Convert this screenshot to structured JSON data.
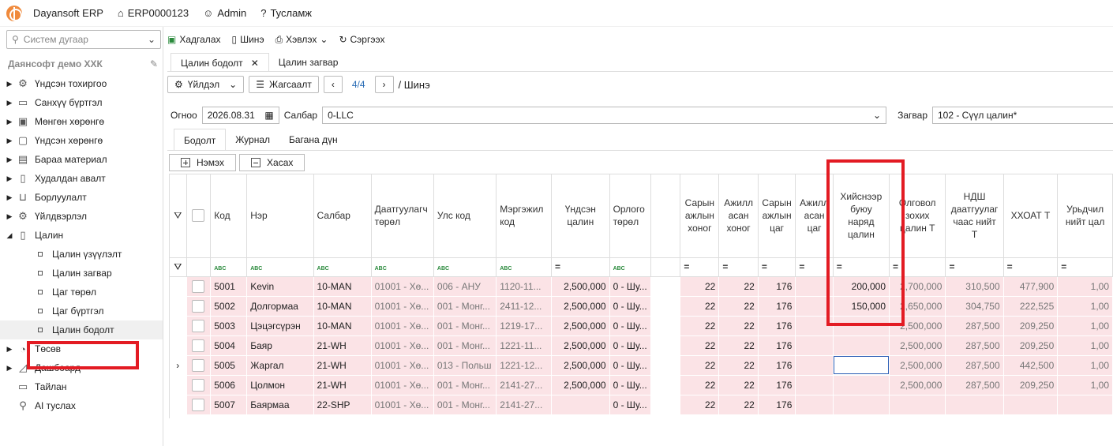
{
  "topbar": {
    "app": "Dayansoft ERP",
    "code": "ERP0000123",
    "user": "Admin",
    "help": "Тусламж"
  },
  "sidebar": {
    "search_placeholder": "Систем дугаар",
    "company": "Даянсофт демо ХХК",
    "items": [
      {
        "label": "Үндсэн тохиргоо",
        "icon": "gear-icon",
        "glyph": "⚙"
      },
      {
        "label": "Санхүү бүртгэл",
        "icon": "ledger-icon",
        "glyph": "▭"
      },
      {
        "label": "Мөнгөн хөрөнгө",
        "icon": "cash-icon",
        "glyph": "▣"
      },
      {
        "label": "Үндсэн хөрөнгө",
        "icon": "asset-icon",
        "glyph": "▢"
      },
      {
        "label": "Бараа материал",
        "icon": "inventory-icon",
        "glyph": "▤"
      },
      {
        "label": "Худалдан авалт",
        "icon": "purchase-icon",
        "glyph": "▯"
      },
      {
        "label": "Борлуулалт",
        "icon": "cart-icon",
        "glyph": "⊔"
      },
      {
        "label": "Үйлдвэрлэл",
        "icon": "production-icon",
        "glyph": "⚙"
      },
      {
        "label": "Цалин",
        "icon": "salary-icon",
        "glyph": "▯"
      }
    ],
    "subitems": [
      "Цалин үзүүлэлт",
      "Цалин загвар",
      "Цаг төрөл",
      "Цаг бүртгэл",
      "Цалин бодолт"
    ],
    "items_after": [
      {
        "label": "Төсөв",
        "icon": "budget-icon",
        "glyph": "◔"
      },
      {
        "label": "Дашбоард",
        "icon": "dashboard-icon",
        "glyph": "◿"
      },
      {
        "label": "Тайлан",
        "icon": "report-icon",
        "glyph": "▭"
      },
      {
        "label": "AI туслах",
        "icon": "assistant-icon",
        "glyph": "⚲"
      }
    ]
  },
  "toolbar": {
    "save": "Хадгалах",
    "new": "Шинэ",
    "print": "Хэвлэх",
    "refresh": "Сэргээх"
  },
  "tabs": {
    "active": "Цалин бодолт",
    "other": "Цалин загвар"
  },
  "nav": {
    "action": "Үйлдэл",
    "sort": "Жагсаалт",
    "page": "4/4",
    "crumb": "/ Шинэ"
  },
  "filters": {
    "date_label": "Огноо",
    "date": "2026.08.31",
    "branch_label": "Салбар",
    "branch": "0-LLC",
    "template_label": "Загвар",
    "template": "102 - Сүүл цалин*"
  },
  "subtabs": [
    "Бодолт",
    "Журнал",
    "Багана дүн"
  ],
  "actions": {
    "add": "Нэмэх",
    "remove": "Хасах"
  },
  "grid": {
    "headers": [
      "Код",
      "Нэр",
      "Салбар",
      "Даатгуулагч төрөл",
      "Улс код",
      "Мэргэжил код",
      "Үндсэн цалин",
      "Орлого төрөл",
      "Сарын ажлын хоног",
      "Ажилласан хоног",
      "Сарын ажлын цаг",
      "Ажилласан цаг",
      "Хийснээр буюу наряд цалин",
      "Олговол зохих цалин Т",
      "НДШ даатгуулагчаас нийт Т",
      "ХХОАТ Т",
      "Урьдчилгаа нийт цалин"
    ],
    "header_visible": [
      "Код",
      "Нэр",
      "Салбар",
      "Даатгуулагч\nтөрөл",
      "Улс код",
      "Мэргэжил\nкод",
      "Үндсэн\nцалин",
      "Орлого\nтөрөл",
      "Сарын\nажлын\nхоног",
      "Ажилл\nасан\nхоног",
      "Сарын\nажлын\nцаг",
      "Ажилл\nасан\nцаг",
      "Хийснээр\nбуюу\nнаряд\nцалин",
      "Олговол\nзохих\nцалин Т",
      "НДШ\nдаатгуулаг\nчаас нийт\nТ",
      "ХХОАТ Т",
      "Урьдчил\nнийт цал"
    ],
    "rows": [
      [
        "5001",
        "Kevin",
        "10-MAN",
        "01001 - Хө...",
        "006 - АНУ",
        "1120-11...",
        "2,500,000",
        "0 - Шу...",
        "22",
        "22",
        "176",
        "",
        "200,000",
        "2,700,000",
        "310,500",
        "477,900",
        "1,00"
      ],
      [
        "5002",
        "Долгормаа",
        "10-MAN",
        "01001 - Хө...",
        "001 - Монг...",
        "2411-12...",
        "2,500,000",
        "0 - Шу...",
        "22",
        "22",
        "176",
        "",
        "150,000",
        "2,650,000",
        "304,750",
        "222,525",
        "1,00"
      ],
      [
        "5003",
        "Цэцэгсүрэн",
        "10-MAN",
        "01001 - Хө...",
        "001 - Монг...",
        "1219-17...",
        "2,500,000",
        "0 - Шу...",
        "22",
        "22",
        "176",
        "",
        "",
        "2,500,000",
        "287,500",
        "209,250",
        "1,00"
      ],
      [
        "5004",
        "Баяр",
        "21-WH",
        "01001 - Хө...",
        "001 - Монг...",
        "1221-11...",
        "2,500,000",
        "0 - Шу...",
        "22",
        "22",
        "176",
        "",
        "",
        "2,500,000",
        "287,500",
        "209,250",
        "1,00"
      ],
      [
        "5005",
        "Жаргал",
        "21-WH",
        "01001 - Хө...",
        "013 - Польш",
        "1221-12...",
        "2,500,000",
        "0 - Шу...",
        "22",
        "22",
        "176",
        "",
        "",
        "2,500,000",
        "287,500",
        "442,500",
        "1,00"
      ],
      [
        "5006",
        "Цолмон",
        "21-WH",
        "01001 - Хө...",
        "001 - Монг...",
        "2141-27...",
        "2,500,000",
        "0 - Шу...",
        "22",
        "22",
        "176",
        "",
        "",
        "2,500,000",
        "287,500",
        "209,250",
        "1,00"
      ],
      [
        "5007",
        "Баярмаа",
        "22-SHP",
        "01001 - Хө...",
        "001 - Монг...",
        "2141-27...",
        "",
        "0 - Шу...",
        "22",
        "22",
        "176",
        "",
        "",
        "",
        "",
        "",
        ""
      ]
    ]
  },
  "colors": {
    "highlight": "#e31b23",
    "row_bg": "#fbe3e6",
    "link": "#2a6db5"
  }
}
